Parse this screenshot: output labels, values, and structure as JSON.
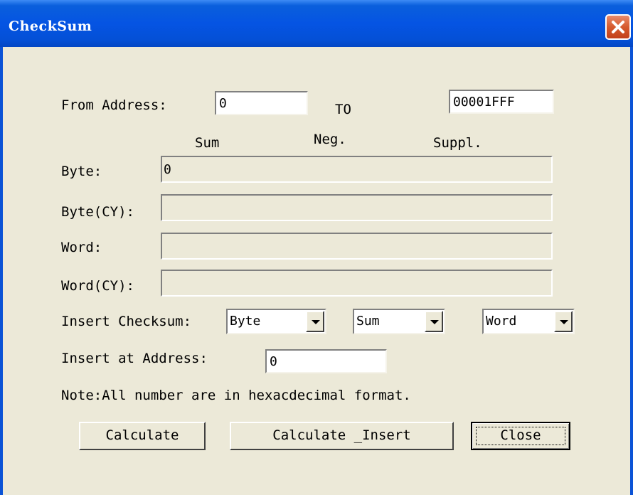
{
  "window": {
    "title": "CheckSum"
  },
  "range": {
    "from_label": "From Address:",
    "from_value": "0",
    "to_label": "TO",
    "to_value": "00001FFF"
  },
  "columns": {
    "sum": "Sum",
    "neg": "Neg.",
    "suppl": "Suppl."
  },
  "results": {
    "byte_label": "Byte:",
    "byte_value": "0",
    "byte_cy_label": "Byte(CY):",
    "byte_cy_value": "",
    "word_label": "Word:",
    "word_value": "",
    "word_cy_label": "Word(CY):",
    "word_cy_value": ""
  },
  "insert": {
    "checksum_label": "Insert Checksum:",
    "size_selected": "Byte",
    "type_selected": "Sum",
    "unit_selected": "Word",
    "address_label": "Insert at Address:",
    "address_value": "0"
  },
  "note": "Note:All number are in hexacdecimal format.",
  "buttons": {
    "calculate": "Calculate",
    "calculate_insert": "Calculate _Insert",
    "close": "Close"
  },
  "icons": {
    "close": "close-x-icon",
    "dropdown": "chevron-down-icon"
  },
  "colors": {
    "titlebar": "#0554e3",
    "dialog_bg": "#ece9d8",
    "close_button": "#d65a2e"
  }
}
